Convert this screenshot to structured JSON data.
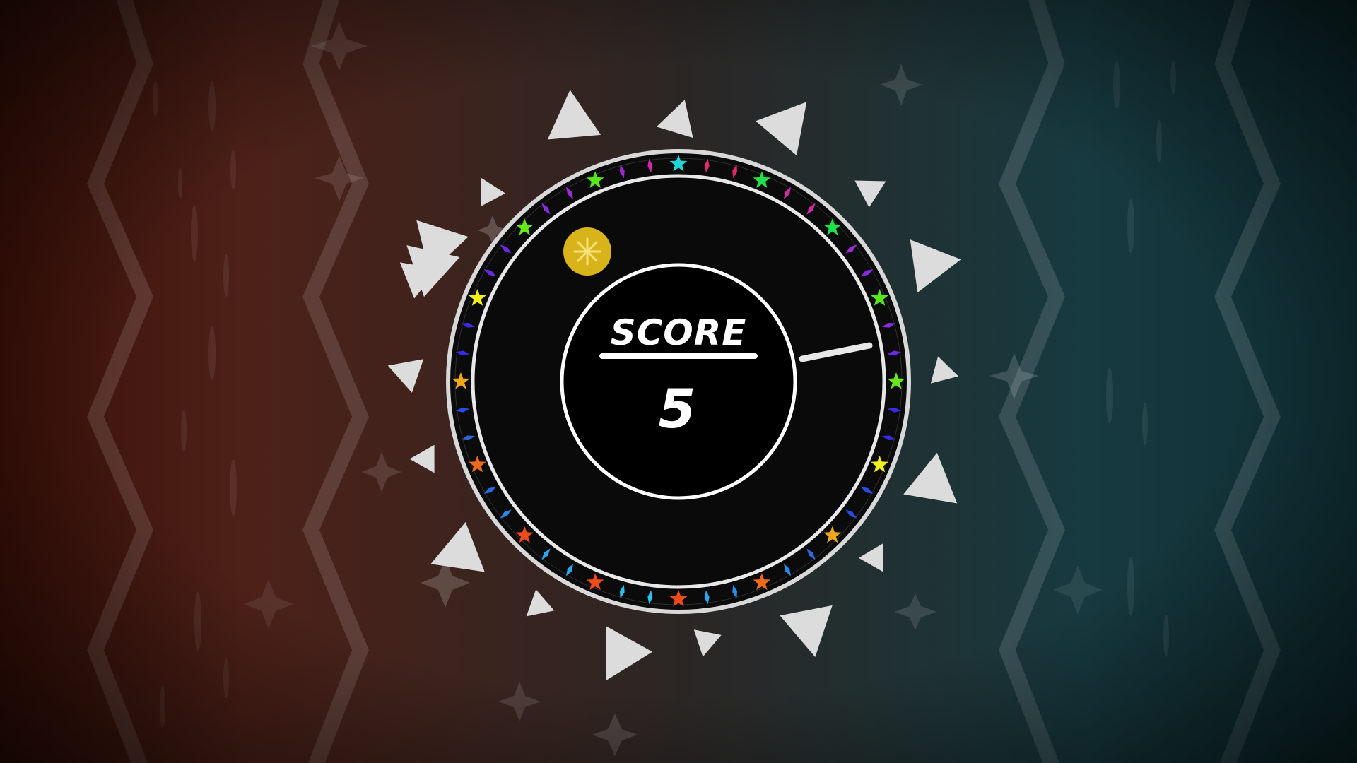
{
  "hud": {
    "score_label": "SCORE",
    "score_value": "5"
  },
  "colors": {
    "bg_left": "#4a1a12",
    "bg_mid": "#2e2422",
    "bg_right": "#163c42",
    "ring_fill": "#0b0b0b",
    "ring_stroke": "#e6e6e6",
    "inner_circle": "#000000",
    "coin": "#d8b41a",
    "coin_mark": "#f6e27a",
    "spike": "#dcdcdc"
  },
  "icons": {
    "coin": "sun-coin-icon",
    "marker": "star-icon",
    "divider": "diamond-icon",
    "sparkle": "sparkle-icon",
    "spike": "triangle-spike-icon"
  },
  "ring_markers": {
    "star_colors": [
      "#22d4d4",
      "#22e04a",
      "#22e04a",
      "#55e81a",
      "#66e81a",
      "#f0f01a",
      "#f0a81a",
      "#f06a1a",
      "#f04a1a",
      "#f04a1a",
      "#f04a1a",
      "#f06a1a",
      "#f0a81a",
      "#f0f01a",
      "#66e81a",
      "#55e81a"
    ],
    "diamond_colors": [
      "#e02a6a",
      "#d02aa8",
      "#a02ad8",
      "#8a2ae0",
      "#6a2ae0",
      "#3a2ae0",
      "#2a4ae0",
      "#2a6ae0",
      "#2a8ae8",
      "#2aa8f0",
      "#2ac0f0",
      "#2aa8f0",
      "#2a8ae8",
      "#2a6ae0",
      "#2a4ae0",
      "#3a2ae0",
      "#6a2ae0",
      "#8a2ae0",
      "#a02ad8",
      "#d02aa8"
    ]
  }
}
